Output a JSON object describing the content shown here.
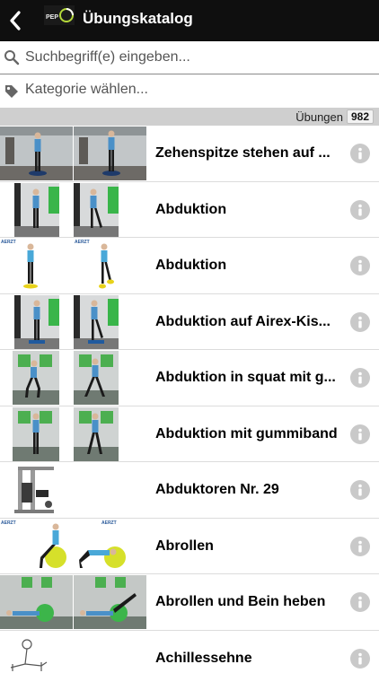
{
  "header": {
    "title": "Übungskatalog",
    "logo_text": "PEP"
  },
  "search": {
    "placeholder": "Suchbegriff(e) eingeben..."
  },
  "category": {
    "label": "Kategorie wählen..."
  },
  "count": {
    "label": "Übungen",
    "value": "982"
  },
  "exercises": [
    {
      "title": "Zehenspitze stehen auf ..."
    },
    {
      "title": "Abduktion"
    },
    {
      "title": "Abduktion"
    },
    {
      "title": "Abduktion auf Airex-Kis..."
    },
    {
      "title": "Abduktion in squat mit g..."
    },
    {
      "title": "Abduktion mit gummiband"
    },
    {
      "title": "Abduktoren Nr. 29"
    },
    {
      "title": "Abrollen"
    },
    {
      "title": "Abrollen und Bein heben"
    },
    {
      "title": "Achillessehne"
    }
  ],
  "thumbnail_logo_text": "AERZT",
  "colors": {
    "topbar": "#0f0f0f",
    "count_bar": "#cfcfcf",
    "info_icon": "#c9c9c9",
    "accent_green": "#b4d83a",
    "shirt_blue": "#4a90c8"
  }
}
